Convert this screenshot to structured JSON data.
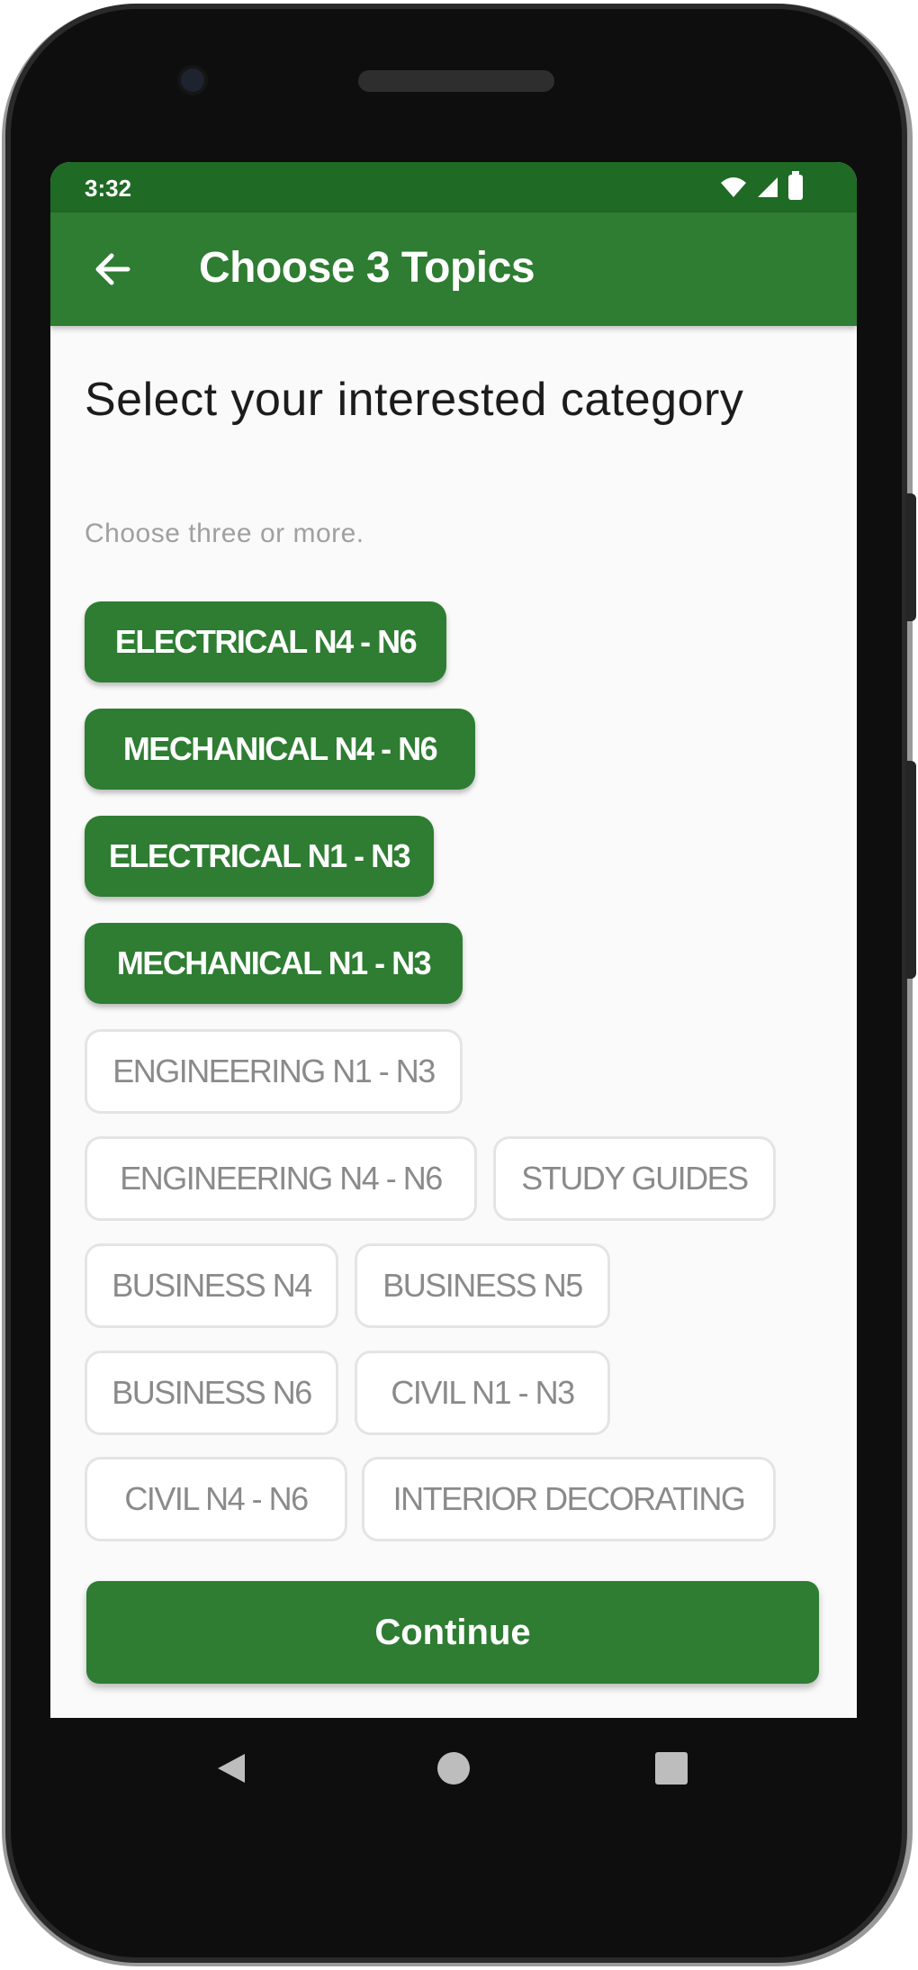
{
  "status_bar": {
    "time": "3:32"
  },
  "app_bar": {
    "title": "Choose 3 Topics"
  },
  "content": {
    "heading": "Select your interested category",
    "subheading": "Choose three or more."
  },
  "chips": [
    {
      "label": "ELECTRICAL N4 - N6",
      "selected": true
    },
    {
      "label": "MECHANICAL N4 - N6",
      "selected": true
    },
    {
      "label": "ELECTRICAL N1 - N3",
      "selected": true
    },
    {
      "label": "MECHANICAL N1 - N3",
      "selected": true
    },
    {
      "label": "ENGINEERING N1 - N3",
      "selected": false
    },
    {
      "label": "ENGINEERING N4 - N6",
      "selected": false
    },
    {
      "label": "STUDY GUIDES",
      "selected": false
    },
    {
      "label": "BUSINESS N4",
      "selected": false
    },
    {
      "label": "BUSINESS N5",
      "selected": false
    },
    {
      "label": "BUSINESS N6",
      "selected": false
    },
    {
      "label": "CIVIL N1 - N3",
      "selected": false
    },
    {
      "label": "CIVIL N4 - N6",
      "selected": false
    },
    {
      "label": "INTERIOR DECORATING",
      "selected": false
    }
  ],
  "actions": {
    "continue_label": "Continue"
  },
  "colors": {
    "primary": "#2e7d32",
    "status_bar": "#1f6a24",
    "chip_unselected_text": "#8a8a8a",
    "background": "#fafafa"
  },
  "icons": {
    "back": "arrow-left-icon",
    "wifi": "wifi-icon",
    "signal": "signal-icon",
    "battery": "battery-icon",
    "nav_back": "nav-back-icon",
    "nav_home": "nav-home-icon",
    "nav_recents": "nav-recents-icon"
  }
}
